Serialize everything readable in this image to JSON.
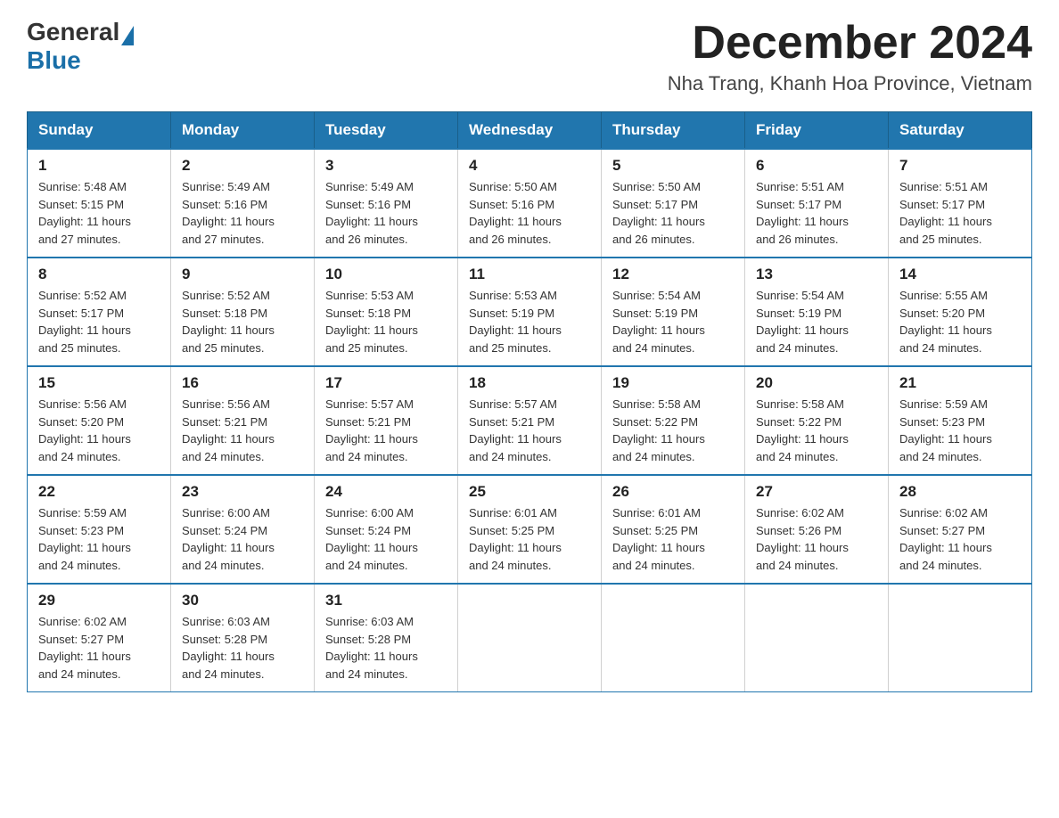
{
  "header": {
    "logo_general": "General",
    "logo_blue": "Blue",
    "month_title": "December 2024",
    "location": "Nha Trang, Khanh Hoa Province, Vietnam"
  },
  "days_of_week": [
    "Sunday",
    "Monday",
    "Tuesday",
    "Wednesday",
    "Thursday",
    "Friday",
    "Saturday"
  ],
  "weeks": [
    [
      {
        "day": "1",
        "sunrise": "5:48 AM",
        "sunset": "5:15 PM",
        "daylight": "11 hours and 27 minutes."
      },
      {
        "day": "2",
        "sunrise": "5:49 AM",
        "sunset": "5:16 PM",
        "daylight": "11 hours and 27 minutes."
      },
      {
        "day": "3",
        "sunrise": "5:49 AM",
        "sunset": "5:16 PM",
        "daylight": "11 hours and 26 minutes."
      },
      {
        "day": "4",
        "sunrise": "5:50 AM",
        "sunset": "5:16 PM",
        "daylight": "11 hours and 26 minutes."
      },
      {
        "day": "5",
        "sunrise": "5:50 AM",
        "sunset": "5:17 PM",
        "daylight": "11 hours and 26 minutes."
      },
      {
        "day": "6",
        "sunrise": "5:51 AM",
        "sunset": "5:17 PM",
        "daylight": "11 hours and 26 minutes."
      },
      {
        "day": "7",
        "sunrise": "5:51 AM",
        "sunset": "5:17 PM",
        "daylight": "11 hours and 25 minutes."
      }
    ],
    [
      {
        "day": "8",
        "sunrise": "5:52 AM",
        "sunset": "5:17 PM",
        "daylight": "11 hours and 25 minutes."
      },
      {
        "day": "9",
        "sunrise": "5:52 AM",
        "sunset": "5:18 PM",
        "daylight": "11 hours and 25 minutes."
      },
      {
        "day": "10",
        "sunrise": "5:53 AM",
        "sunset": "5:18 PM",
        "daylight": "11 hours and 25 minutes."
      },
      {
        "day": "11",
        "sunrise": "5:53 AM",
        "sunset": "5:19 PM",
        "daylight": "11 hours and 25 minutes."
      },
      {
        "day": "12",
        "sunrise": "5:54 AM",
        "sunset": "5:19 PM",
        "daylight": "11 hours and 24 minutes."
      },
      {
        "day": "13",
        "sunrise": "5:54 AM",
        "sunset": "5:19 PM",
        "daylight": "11 hours and 24 minutes."
      },
      {
        "day": "14",
        "sunrise": "5:55 AM",
        "sunset": "5:20 PM",
        "daylight": "11 hours and 24 minutes."
      }
    ],
    [
      {
        "day": "15",
        "sunrise": "5:56 AM",
        "sunset": "5:20 PM",
        "daylight": "11 hours and 24 minutes."
      },
      {
        "day": "16",
        "sunrise": "5:56 AM",
        "sunset": "5:21 PM",
        "daylight": "11 hours and 24 minutes."
      },
      {
        "day": "17",
        "sunrise": "5:57 AM",
        "sunset": "5:21 PM",
        "daylight": "11 hours and 24 minutes."
      },
      {
        "day": "18",
        "sunrise": "5:57 AM",
        "sunset": "5:21 PM",
        "daylight": "11 hours and 24 minutes."
      },
      {
        "day": "19",
        "sunrise": "5:58 AM",
        "sunset": "5:22 PM",
        "daylight": "11 hours and 24 minutes."
      },
      {
        "day": "20",
        "sunrise": "5:58 AM",
        "sunset": "5:22 PM",
        "daylight": "11 hours and 24 minutes."
      },
      {
        "day": "21",
        "sunrise": "5:59 AM",
        "sunset": "5:23 PM",
        "daylight": "11 hours and 24 minutes."
      }
    ],
    [
      {
        "day": "22",
        "sunrise": "5:59 AM",
        "sunset": "5:23 PM",
        "daylight": "11 hours and 24 minutes."
      },
      {
        "day": "23",
        "sunrise": "6:00 AM",
        "sunset": "5:24 PM",
        "daylight": "11 hours and 24 minutes."
      },
      {
        "day": "24",
        "sunrise": "6:00 AM",
        "sunset": "5:24 PM",
        "daylight": "11 hours and 24 minutes."
      },
      {
        "day": "25",
        "sunrise": "6:01 AM",
        "sunset": "5:25 PM",
        "daylight": "11 hours and 24 minutes."
      },
      {
        "day": "26",
        "sunrise": "6:01 AM",
        "sunset": "5:25 PM",
        "daylight": "11 hours and 24 minutes."
      },
      {
        "day": "27",
        "sunrise": "6:02 AM",
        "sunset": "5:26 PM",
        "daylight": "11 hours and 24 minutes."
      },
      {
        "day": "28",
        "sunrise": "6:02 AM",
        "sunset": "5:27 PM",
        "daylight": "11 hours and 24 minutes."
      }
    ],
    [
      {
        "day": "29",
        "sunrise": "6:02 AM",
        "sunset": "5:27 PM",
        "daylight": "11 hours and 24 minutes."
      },
      {
        "day": "30",
        "sunrise": "6:03 AM",
        "sunset": "5:28 PM",
        "daylight": "11 hours and 24 minutes."
      },
      {
        "day": "31",
        "sunrise": "6:03 AM",
        "sunset": "5:28 PM",
        "daylight": "11 hours and 24 minutes."
      },
      null,
      null,
      null,
      null
    ]
  ],
  "cell_labels": {
    "sunrise": "Sunrise:",
    "sunset": "Sunset:",
    "daylight": "Daylight:"
  }
}
